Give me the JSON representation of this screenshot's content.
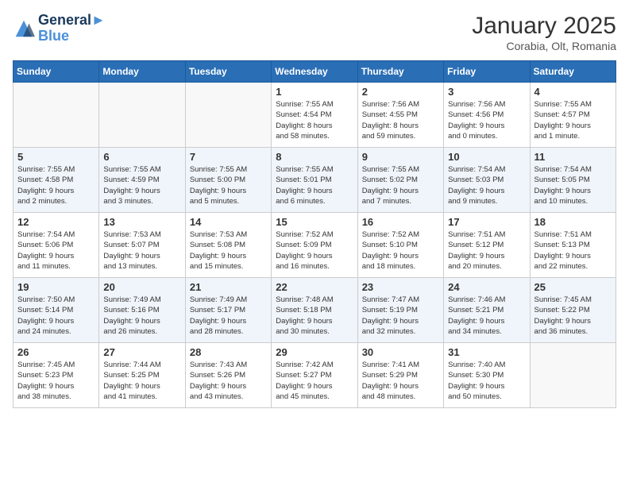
{
  "logo": {
    "line1": "General",
    "line2": "Blue"
  },
  "title": "January 2025",
  "location": "Corabia, Olt, Romania",
  "weekdays": [
    "Sunday",
    "Monday",
    "Tuesday",
    "Wednesday",
    "Thursday",
    "Friday",
    "Saturday"
  ],
  "weeks": [
    [
      {
        "day": "",
        "info": ""
      },
      {
        "day": "",
        "info": ""
      },
      {
        "day": "",
        "info": ""
      },
      {
        "day": "1",
        "info": "Sunrise: 7:55 AM\nSunset: 4:54 PM\nDaylight: 8 hours\nand 58 minutes."
      },
      {
        "day": "2",
        "info": "Sunrise: 7:56 AM\nSunset: 4:55 PM\nDaylight: 8 hours\nand 59 minutes."
      },
      {
        "day": "3",
        "info": "Sunrise: 7:56 AM\nSunset: 4:56 PM\nDaylight: 9 hours\nand 0 minutes."
      },
      {
        "day": "4",
        "info": "Sunrise: 7:55 AM\nSunset: 4:57 PM\nDaylight: 9 hours\nand 1 minute."
      }
    ],
    [
      {
        "day": "5",
        "info": "Sunrise: 7:55 AM\nSunset: 4:58 PM\nDaylight: 9 hours\nand 2 minutes."
      },
      {
        "day": "6",
        "info": "Sunrise: 7:55 AM\nSunset: 4:59 PM\nDaylight: 9 hours\nand 3 minutes."
      },
      {
        "day": "7",
        "info": "Sunrise: 7:55 AM\nSunset: 5:00 PM\nDaylight: 9 hours\nand 5 minutes."
      },
      {
        "day": "8",
        "info": "Sunrise: 7:55 AM\nSunset: 5:01 PM\nDaylight: 9 hours\nand 6 minutes."
      },
      {
        "day": "9",
        "info": "Sunrise: 7:55 AM\nSunset: 5:02 PM\nDaylight: 9 hours\nand 7 minutes."
      },
      {
        "day": "10",
        "info": "Sunrise: 7:54 AM\nSunset: 5:03 PM\nDaylight: 9 hours\nand 9 minutes."
      },
      {
        "day": "11",
        "info": "Sunrise: 7:54 AM\nSunset: 5:05 PM\nDaylight: 9 hours\nand 10 minutes."
      }
    ],
    [
      {
        "day": "12",
        "info": "Sunrise: 7:54 AM\nSunset: 5:06 PM\nDaylight: 9 hours\nand 11 minutes."
      },
      {
        "day": "13",
        "info": "Sunrise: 7:53 AM\nSunset: 5:07 PM\nDaylight: 9 hours\nand 13 minutes."
      },
      {
        "day": "14",
        "info": "Sunrise: 7:53 AM\nSunset: 5:08 PM\nDaylight: 9 hours\nand 15 minutes."
      },
      {
        "day": "15",
        "info": "Sunrise: 7:52 AM\nSunset: 5:09 PM\nDaylight: 9 hours\nand 16 minutes."
      },
      {
        "day": "16",
        "info": "Sunrise: 7:52 AM\nSunset: 5:10 PM\nDaylight: 9 hours\nand 18 minutes."
      },
      {
        "day": "17",
        "info": "Sunrise: 7:51 AM\nSunset: 5:12 PM\nDaylight: 9 hours\nand 20 minutes."
      },
      {
        "day": "18",
        "info": "Sunrise: 7:51 AM\nSunset: 5:13 PM\nDaylight: 9 hours\nand 22 minutes."
      }
    ],
    [
      {
        "day": "19",
        "info": "Sunrise: 7:50 AM\nSunset: 5:14 PM\nDaylight: 9 hours\nand 24 minutes."
      },
      {
        "day": "20",
        "info": "Sunrise: 7:49 AM\nSunset: 5:16 PM\nDaylight: 9 hours\nand 26 minutes."
      },
      {
        "day": "21",
        "info": "Sunrise: 7:49 AM\nSunset: 5:17 PM\nDaylight: 9 hours\nand 28 minutes."
      },
      {
        "day": "22",
        "info": "Sunrise: 7:48 AM\nSunset: 5:18 PM\nDaylight: 9 hours\nand 30 minutes."
      },
      {
        "day": "23",
        "info": "Sunrise: 7:47 AM\nSunset: 5:19 PM\nDaylight: 9 hours\nand 32 minutes."
      },
      {
        "day": "24",
        "info": "Sunrise: 7:46 AM\nSunset: 5:21 PM\nDaylight: 9 hours\nand 34 minutes."
      },
      {
        "day": "25",
        "info": "Sunrise: 7:45 AM\nSunset: 5:22 PM\nDaylight: 9 hours\nand 36 minutes."
      }
    ],
    [
      {
        "day": "26",
        "info": "Sunrise: 7:45 AM\nSunset: 5:23 PM\nDaylight: 9 hours\nand 38 minutes."
      },
      {
        "day": "27",
        "info": "Sunrise: 7:44 AM\nSunset: 5:25 PM\nDaylight: 9 hours\nand 41 minutes."
      },
      {
        "day": "28",
        "info": "Sunrise: 7:43 AM\nSunset: 5:26 PM\nDaylight: 9 hours\nand 43 minutes."
      },
      {
        "day": "29",
        "info": "Sunrise: 7:42 AM\nSunset: 5:27 PM\nDaylight: 9 hours\nand 45 minutes."
      },
      {
        "day": "30",
        "info": "Sunrise: 7:41 AM\nSunset: 5:29 PM\nDaylight: 9 hours\nand 48 minutes."
      },
      {
        "day": "31",
        "info": "Sunrise: 7:40 AM\nSunset: 5:30 PM\nDaylight: 9 hours\nand 50 minutes."
      },
      {
        "day": "",
        "info": ""
      }
    ]
  ]
}
